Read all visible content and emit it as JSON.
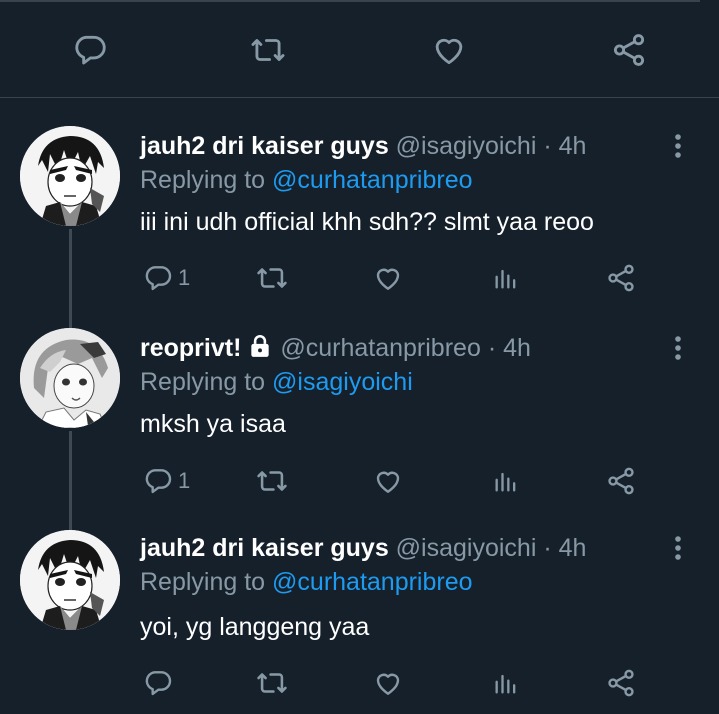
{
  "tweets": [
    {
      "name": "jauh2 dri kaiser guys",
      "handle": "@isagiyoichi",
      "dot": "·",
      "time": "4h",
      "replying_prefix": "Replying to",
      "replying_to": "@curhatanpribreo",
      "text": "iii ini udh official khh sdh?? slmt yaa reoo",
      "reply_count": "1"
    },
    {
      "name": "reoprivt!",
      "handle": "@curhatanpribreo",
      "dot": "·",
      "time": "4h",
      "replying_prefix": "Replying to",
      "replying_to": "@isagiyoichi",
      "text": "mksh ya isaa",
      "reply_count": "1"
    },
    {
      "name": "jauh2 dri kaiser guys",
      "handle": "@isagiyoichi",
      "dot": "·",
      "time": "4h",
      "replying_prefix": "Replying to",
      "replying_to": "@curhatanpribreo",
      "text": "yoi, yg langgeng yaa",
      "reply_count": ""
    }
  ],
  "icons": {
    "reply": "reply-icon",
    "retweet": "retweet-icon",
    "like": "heart-icon",
    "views": "bar-chart-icon",
    "share": "share-icon",
    "more": "more-vertical-icon",
    "lock": "lock-icon"
  },
  "colors": {
    "background": "#15202b",
    "secondary_text": "#8899a6",
    "link": "#1d9bf0",
    "divider": "#38444d"
  }
}
